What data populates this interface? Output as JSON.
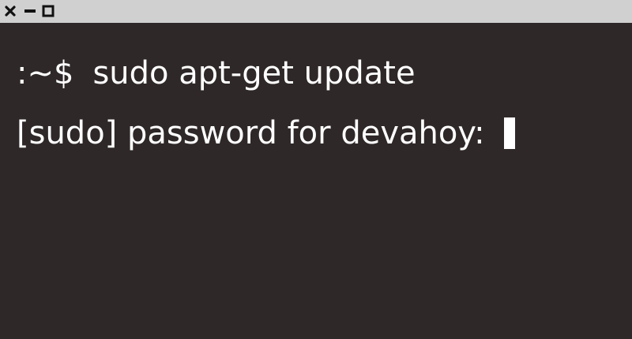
{
  "window": {
    "buttons": {
      "close_icon": "close-icon",
      "minimize_icon": "minimize-icon",
      "maximize_icon": "maximize-icon"
    }
  },
  "terminal": {
    "lines": [
      {
        "prompt": ":~$",
        "command": "sudo apt-get update"
      },
      {
        "text": "[sudo] password for devahoy:"
      }
    ],
    "colors": {
      "background": "#2f2828",
      "foreground": "#ffffff",
      "titlebar": "#d0d0d0"
    }
  }
}
